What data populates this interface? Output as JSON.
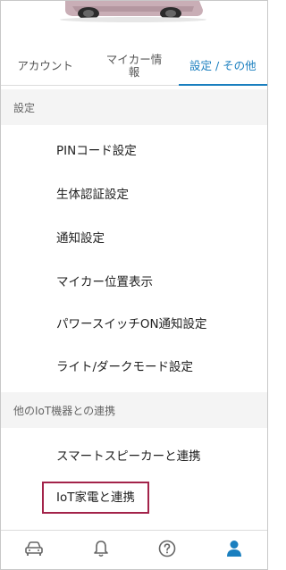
{
  "tabs": [
    {
      "label": "アカウント",
      "active": false
    },
    {
      "label": "マイカー情報",
      "active": false
    },
    {
      "label": "設定 / その他",
      "active": true
    }
  ],
  "sections": [
    {
      "title": "設定",
      "items": [
        "PINコード設定",
        "生体認証設定",
        "通知設定",
        "マイカー位置表示",
        "パワースイッチON通知設定",
        "ライト/ダークモード設定"
      ]
    },
    {
      "title": "他のIoT機器との連携",
      "items": [
        "スマートスピーカーと連携",
        "IoT家電と連携"
      ]
    }
  ],
  "bottom_nav": [
    {
      "icon": "car-icon",
      "active": false
    },
    {
      "icon": "bell-icon",
      "active": false
    },
    {
      "icon": "help-icon",
      "active": false
    },
    {
      "icon": "person-icon",
      "active": true
    }
  ],
  "colors": {
    "accent": "#1a7fbf",
    "highlight_border": "#a3234a",
    "section_bg": "#f4f4f4",
    "car_body": "#c9aeb6"
  }
}
